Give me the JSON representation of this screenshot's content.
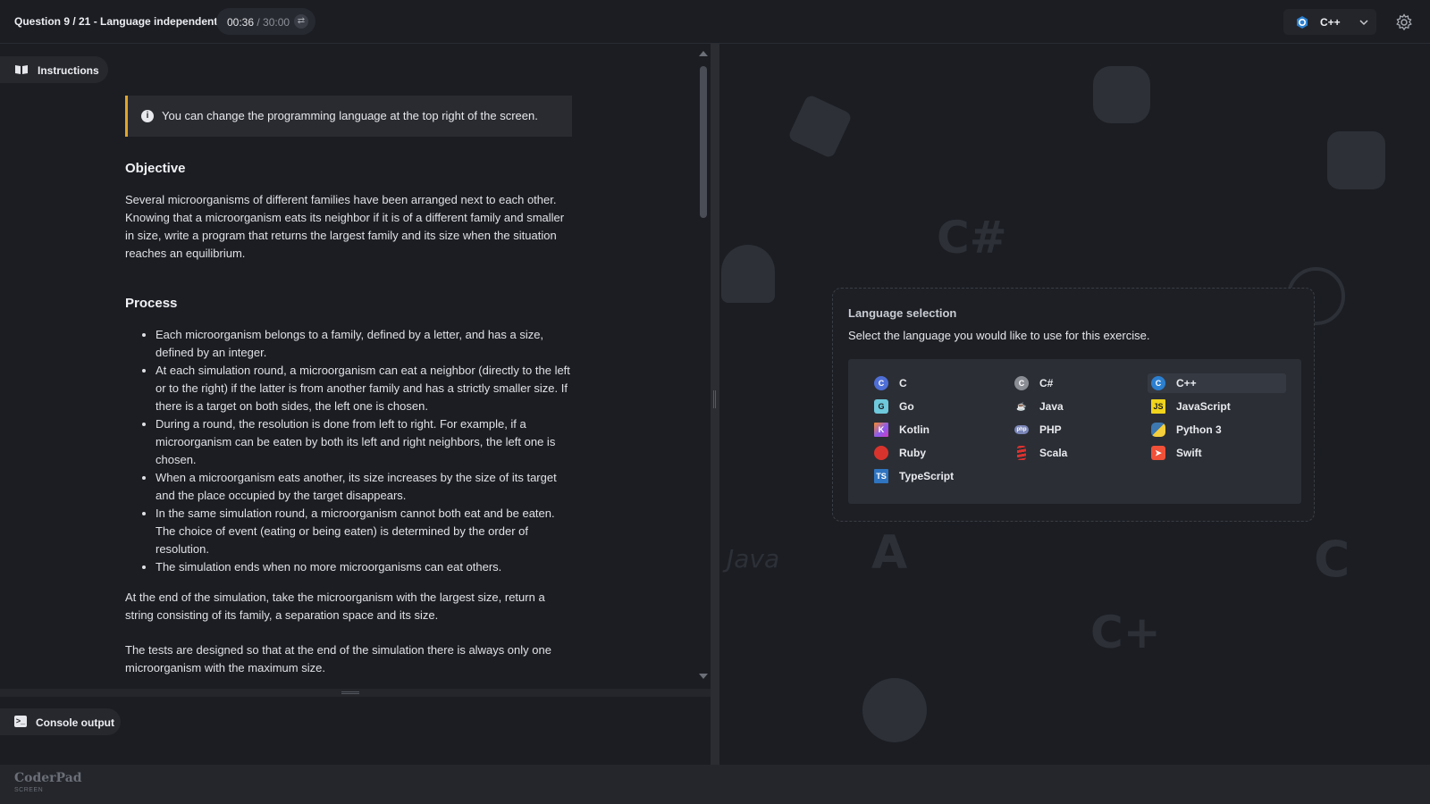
{
  "header": {
    "question_title": "Question 9 / 21 - Language independent",
    "timer_elapsed": "00:36",
    "timer_separator": " / ",
    "timer_total": "30:00",
    "selected_language": "C++"
  },
  "instructions": {
    "tab_label": "Instructions",
    "info_text": "You can change the programming language at the top right of the screen.",
    "objective_heading": "Objective",
    "objective_text": "Several microorganisms of different families have been arranged next to each other. Knowing that a microorganism eats its neighbor if it is of a different family and smaller in size, write a program that returns the largest family and its size when the situation reaches an equilibrium.",
    "process_heading": "Process",
    "process_items": [
      "Each microorganism belongs to a family, defined by a letter, and has a size, defined by an integer.",
      "At each simulation round, a microorganism can eat a neighbor (directly to the left or to the right) if the latter is from another family and has a strictly smaller size. If there is a target on both sides, the left one is chosen.",
      "During a round, the resolution is done from left to right. For example, if a microorganism can be eaten by both its left and right neighbors, the left one is chosen.",
      "When a microorganism eats another, its size increases by the size of its target and the place occupied by the target disappears.",
      "In the same simulation round, a microorganism cannot both eat and be eaten. The choice of event (eating or being eaten) is determined by the order of resolution.",
      "The simulation ends when no more microorganisms can eat others."
    ],
    "para_end": "At the end of the simulation, take the microorganism with the largest size, return a string consisting of its family, a separation space and its size.",
    "para_tests": "The tests are designed so that at the end of the simulation there is always only one microorganism with the maximum size."
  },
  "console": {
    "tab_label": "Console output"
  },
  "language_dialog": {
    "title": "Language selection",
    "description": "Select the language you would like to use for this exercise.",
    "languages": [
      {
        "name": "C",
        "icon": "c-logo-icon",
        "color": "#4f6fd6"
      },
      {
        "name": "C#",
        "icon": "csharp-logo-icon",
        "color": "#8a8d94"
      },
      {
        "name": "C++",
        "icon": "cpp-logo-icon",
        "color": "#2b7fd0"
      },
      {
        "name": "Go",
        "icon": "go-logo-icon",
        "color": "#6ec9dc"
      },
      {
        "name": "Java",
        "icon": "java-logo-icon",
        "color": "#d8542b"
      },
      {
        "name": "JavaScript",
        "icon": "javascript-logo-icon",
        "color": "#f0d41c"
      },
      {
        "name": "Kotlin",
        "icon": "kotlin-logo-icon",
        "color": "#8a5cf0"
      },
      {
        "name": "PHP",
        "icon": "php-logo-icon",
        "color": "#7a86b8"
      },
      {
        "name": "Python 3",
        "icon": "python-logo-icon",
        "color": "#3d78b0"
      },
      {
        "name": "Ruby",
        "icon": "ruby-logo-icon",
        "color": "#d8342d"
      },
      {
        "name": "Scala",
        "icon": "scala-logo-icon",
        "color": "#dc322f"
      },
      {
        "name": "Swift",
        "icon": "swift-logo-icon",
        "color": "#f05138"
      },
      {
        "name": "TypeScript",
        "icon": "typescript-logo-icon",
        "color": "#2f74c0"
      }
    ],
    "selected": "C++"
  },
  "footer": {
    "brand": "CoderPad",
    "brand_sub": "SCREEN"
  },
  "colors": {
    "accent_info": "#e0a52a",
    "background": "#1b1d23"
  }
}
